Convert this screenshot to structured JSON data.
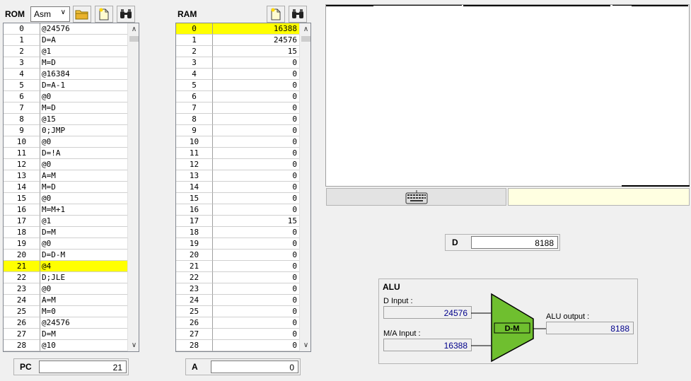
{
  "rom": {
    "title": "ROM",
    "format_select": "Asm",
    "open_button_icon": "folder-icon",
    "new_button_icon": "new-file-icon",
    "find_button_icon": "binoculars-icon",
    "highlighted_row": 21,
    "rows": [
      {
        "idx": "0",
        "val": "@24576"
      },
      {
        "idx": "1",
        "val": "D=A"
      },
      {
        "idx": "2",
        "val": "@1"
      },
      {
        "idx": "3",
        "val": "M=D"
      },
      {
        "idx": "4",
        "val": "@16384"
      },
      {
        "idx": "5",
        "val": "D=A-1"
      },
      {
        "idx": "6",
        "val": "@0"
      },
      {
        "idx": "7",
        "val": "M=D"
      },
      {
        "idx": "8",
        "val": "@15"
      },
      {
        "idx": "9",
        "val": "0;JMP"
      },
      {
        "idx": "10",
        "val": "@0"
      },
      {
        "idx": "11",
        "val": "D=!A"
      },
      {
        "idx": "12",
        "val": "@0"
      },
      {
        "idx": "13",
        "val": "A=M"
      },
      {
        "idx": "14",
        "val": "M=D"
      },
      {
        "idx": "15",
        "val": "@0"
      },
      {
        "idx": "16",
        "val": "M=M+1"
      },
      {
        "idx": "17",
        "val": "@1"
      },
      {
        "idx": "18",
        "val": "D=M"
      },
      {
        "idx": "19",
        "val": "@0"
      },
      {
        "idx": "20",
        "val": "D=D-M"
      },
      {
        "idx": "21",
        "val": "@4"
      },
      {
        "idx": "22",
        "val": "D;JLE"
      },
      {
        "idx": "23",
        "val": "@0"
      },
      {
        "idx": "24",
        "val": "A=M"
      },
      {
        "idx": "25",
        "val": "M=0"
      },
      {
        "idx": "26",
        "val": "@24576"
      },
      {
        "idx": "27",
        "val": "D=M"
      },
      {
        "idx": "28",
        "val": "@10"
      }
    ]
  },
  "ram": {
    "title": "RAM",
    "new_button_icon": "new-file-icon",
    "find_button_icon": "binoculars-icon",
    "highlighted_row": 0,
    "rows": [
      {
        "idx": "0",
        "val": "16388"
      },
      {
        "idx": "1",
        "val": "24576"
      },
      {
        "idx": "2",
        "val": "15"
      },
      {
        "idx": "3",
        "val": "0"
      },
      {
        "idx": "4",
        "val": "0"
      },
      {
        "idx": "5",
        "val": "0"
      },
      {
        "idx": "6",
        "val": "0"
      },
      {
        "idx": "7",
        "val": "0"
      },
      {
        "idx": "8",
        "val": "0"
      },
      {
        "idx": "9",
        "val": "0"
      },
      {
        "idx": "10",
        "val": "0"
      },
      {
        "idx": "11",
        "val": "0"
      },
      {
        "idx": "12",
        "val": "0"
      },
      {
        "idx": "13",
        "val": "0"
      },
      {
        "idx": "14",
        "val": "0"
      },
      {
        "idx": "15",
        "val": "0"
      },
      {
        "idx": "16",
        "val": "0"
      },
      {
        "idx": "17",
        "val": "15"
      },
      {
        "idx": "18",
        "val": "0"
      },
      {
        "idx": "19",
        "val": "0"
      },
      {
        "idx": "20",
        "val": "0"
      },
      {
        "idx": "21",
        "val": "0"
      },
      {
        "idx": "22",
        "val": "0"
      },
      {
        "idx": "23",
        "val": "0"
      },
      {
        "idx": "24",
        "val": "0"
      },
      {
        "idx": "25",
        "val": "0"
      },
      {
        "idx": "26",
        "val": "0"
      },
      {
        "idx": "27",
        "val": "0"
      },
      {
        "idx": "28",
        "val": "0"
      }
    ]
  },
  "pc": {
    "label": "PC",
    "value": "21"
  },
  "a_register": {
    "label": "A",
    "value": "0"
  },
  "d_register": {
    "label": "D",
    "value": "8188"
  },
  "screen": {
    "keyboard_icon": "keyboard-icon"
  },
  "alu": {
    "title": "ALU",
    "d_input_label": "D Input :",
    "d_input_value": "24576",
    "ma_input_label": "M/A Input :",
    "ma_input_value": "16388",
    "operation": "D-M",
    "output_label": "ALU output :",
    "output_value": "8188",
    "color": "#6fbf2f"
  },
  "colors": {
    "highlight": "#ffff00",
    "background": "#f0f0f0"
  }
}
